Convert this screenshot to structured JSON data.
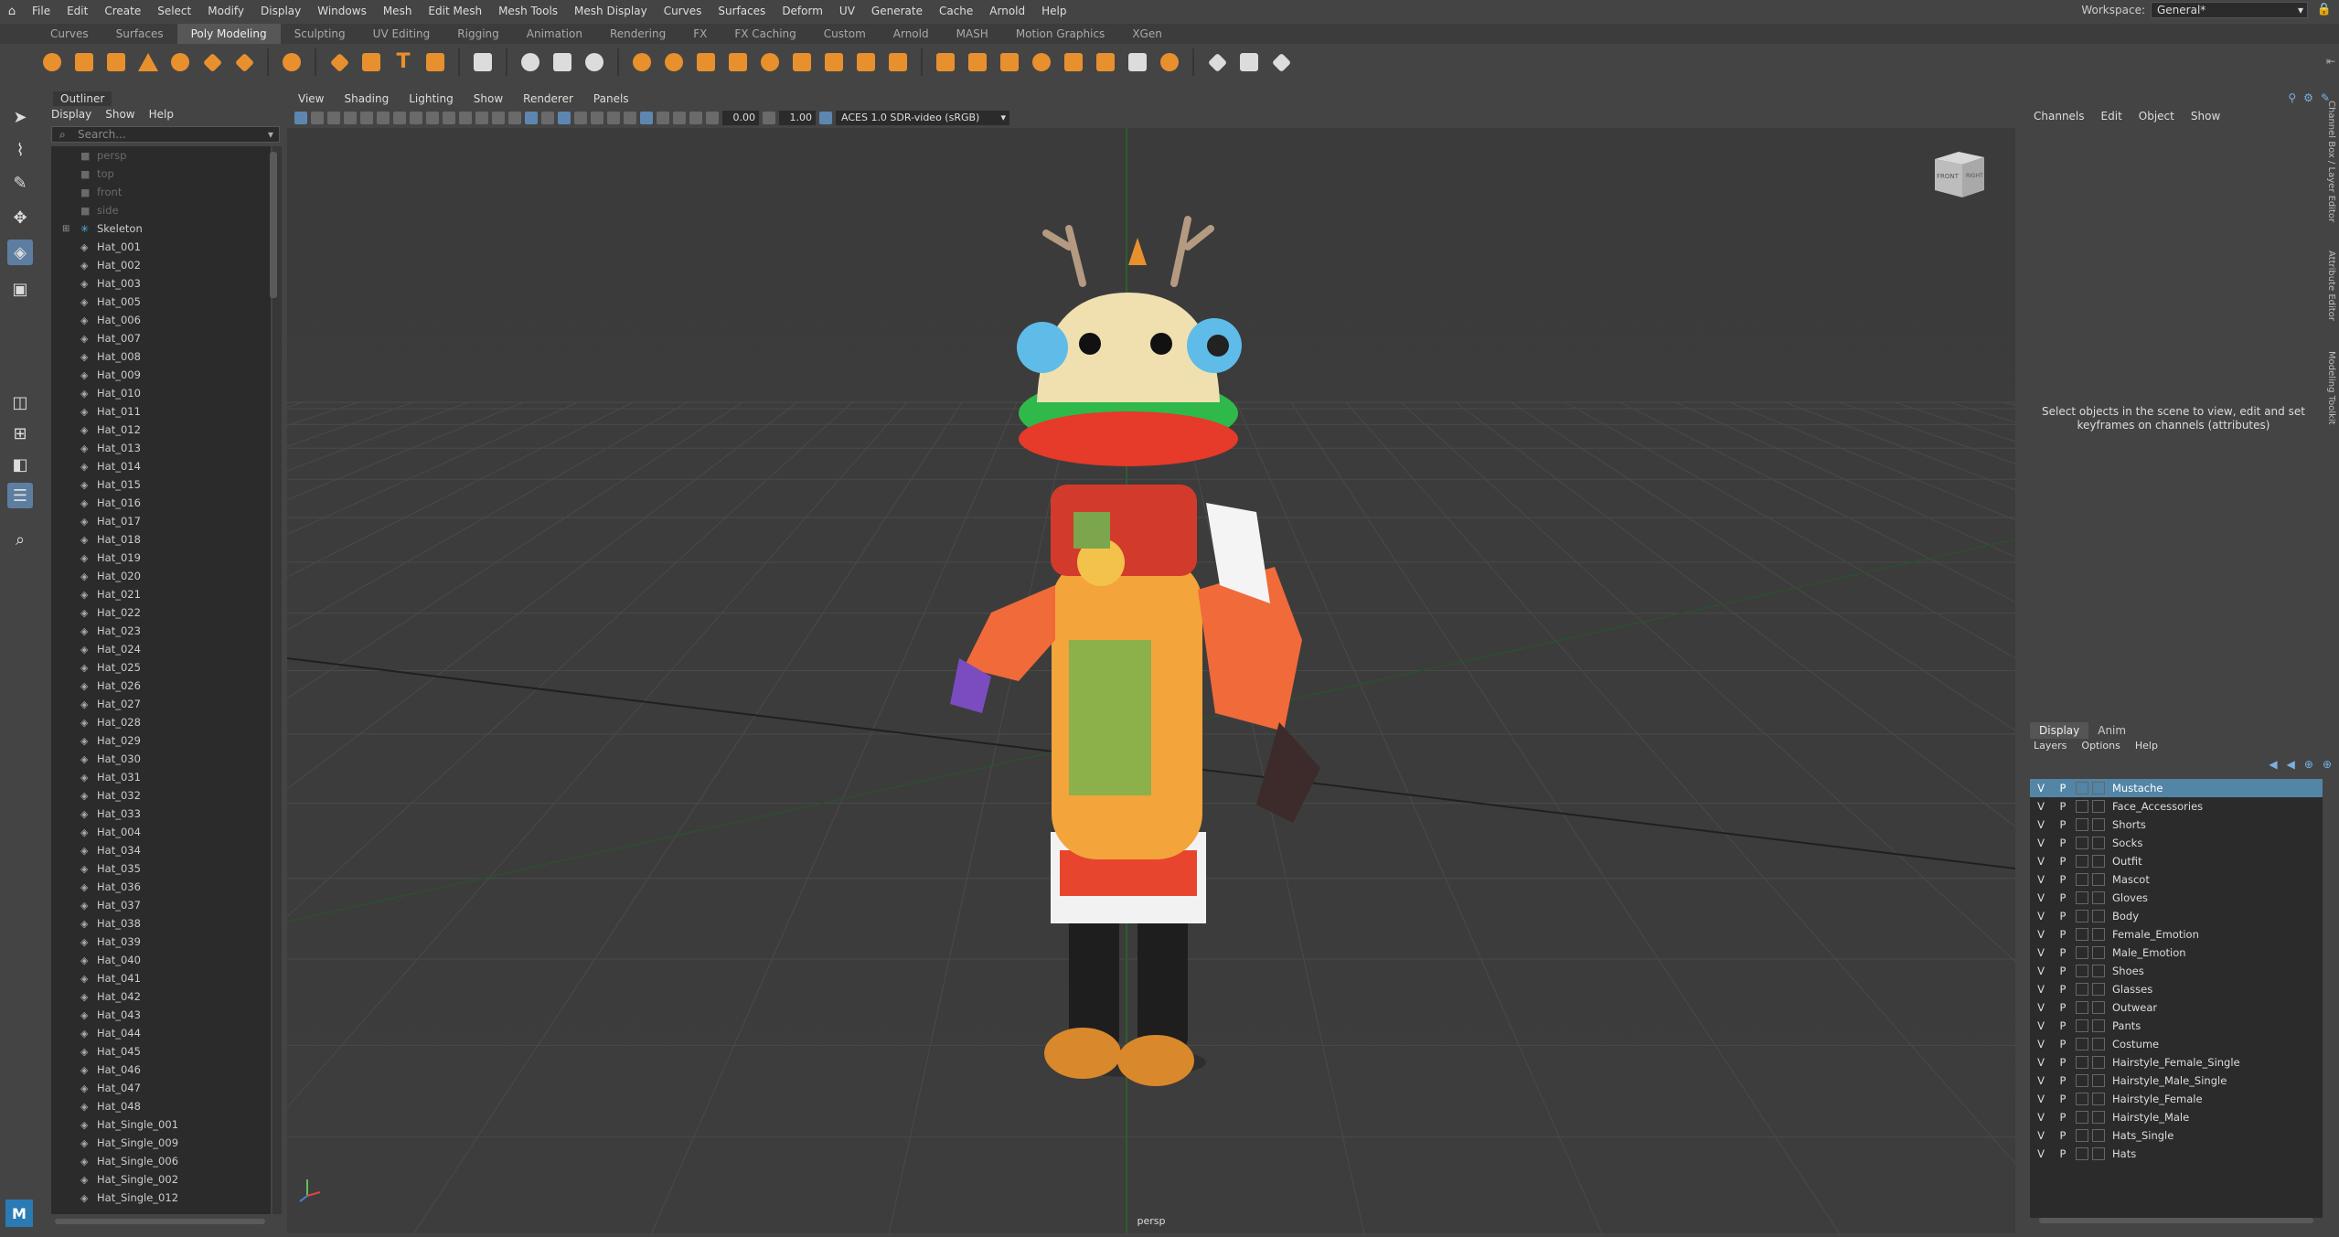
{
  "menubar": {
    "items": [
      "File",
      "Edit",
      "Create",
      "Select",
      "Modify",
      "Display",
      "Windows",
      "Mesh",
      "Edit Mesh",
      "Mesh Tools",
      "Mesh Display",
      "Curves",
      "Surfaces",
      "Deform",
      "UV",
      "Generate",
      "Cache",
      "Arnold",
      "Help"
    ],
    "workspace_label": "Workspace:",
    "workspace_value": "General*"
  },
  "shelf": {
    "tabs": [
      "Curves",
      "Surfaces",
      "Poly Modeling",
      "Sculpting",
      "UV Editing",
      "Rigging",
      "Animation",
      "Rendering",
      "FX",
      "FX Caching",
      "Custom",
      "Arnold",
      "MASH",
      "Motion Graphics",
      "XGen"
    ],
    "active_tab": "Poly Modeling"
  },
  "outliner": {
    "title": "Outliner",
    "menu": [
      "Display",
      "Show",
      "Help"
    ],
    "search_placeholder": "Search...",
    "items": [
      {
        "label": "persp",
        "type": "camera",
        "dim": true
      },
      {
        "label": "top",
        "type": "camera",
        "dim": true
      },
      {
        "label": "front",
        "type": "camera",
        "dim": true
      },
      {
        "label": "side",
        "type": "camera",
        "dim": true
      },
      {
        "label": "Skeleton",
        "type": "skeleton",
        "expandable": true
      },
      {
        "label": "Hat_001",
        "type": "mesh"
      },
      {
        "label": "Hat_002",
        "type": "mesh"
      },
      {
        "label": "Hat_003",
        "type": "mesh"
      },
      {
        "label": "Hat_005",
        "type": "mesh"
      },
      {
        "label": "Hat_006",
        "type": "mesh"
      },
      {
        "label": "Hat_007",
        "type": "mesh"
      },
      {
        "label": "Hat_008",
        "type": "mesh"
      },
      {
        "label": "Hat_009",
        "type": "mesh"
      },
      {
        "label": "Hat_010",
        "type": "mesh"
      },
      {
        "label": "Hat_011",
        "type": "mesh"
      },
      {
        "label": "Hat_012",
        "type": "mesh"
      },
      {
        "label": "Hat_013",
        "type": "mesh"
      },
      {
        "label": "Hat_014",
        "type": "mesh"
      },
      {
        "label": "Hat_015",
        "type": "mesh"
      },
      {
        "label": "Hat_016",
        "type": "mesh"
      },
      {
        "label": "Hat_017",
        "type": "mesh"
      },
      {
        "label": "Hat_018",
        "type": "mesh"
      },
      {
        "label": "Hat_019",
        "type": "mesh"
      },
      {
        "label": "Hat_020",
        "type": "mesh"
      },
      {
        "label": "Hat_021",
        "type": "mesh"
      },
      {
        "label": "Hat_022",
        "type": "mesh"
      },
      {
        "label": "Hat_023",
        "type": "mesh"
      },
      {
        "label": "Hat_024",
        "type": "mesh"
      },
      {
        "label": "Hat_025",
        "type": "mesh"
      },
      {
        "label": "Hat_026",
        "type": "mesh"
      },
      {
        "label": "Hat_027",
        "type": "mesh"
      },
      {
        "label": "Hat_028",
        "type": "mesh"
      },
      {
        "label": "Hat_029",
        "type": "mesh"
      },
      {
        "label": "Hat_030",
        "type": "mesh"
      },
      {
        "label": "Hat_031",
        "type": "mesh"
      },
      {
        "label": "Hat_032",
        "type": "mesh"
      },
      {
        "label": "Hat_033",
        "type": "mesh"
      },
      {
        "label": "Hat_004",
        "type": "mesh"
      },
      {
        "label": "Hat_034",
        "type": "mesh"
      },
      {
        "label": "Hat_035",
        "type": "mesh"
      },
      {
        "label": "Hat_036",
        "type": "mesh"
      },
      {
        "label": "Hat_037",
        "type": "mesh"
      },
      {
        "label": "Hat_038",
        "type": "mesh"
      },
      {
        "label": "Hat_039",
        "type": "mesh"
      },
      {
        "label": "Hat_040",
        "type": "mesh"
      },
      {
        "label": "Hat_041",
        "type": "mesh"
      },
      {
        "label": "Hat_042",
        "type": "mesh"
      },
      {
        "label": "Hat_043",
        "type": "mesh"
      },
      {
        "label": "Hat_044",
        "type": "mesh"
      },
      {
        "label": "Hat_045",
        "type": "mesh"
      },
      {
        "label": "Hat_046",
        "type": "mesh"
      },
      {
        "label": "Hat_047",
        "type": "mesh"
      },
      {
        "label": "Hat_048",
        "type": "mesh"
      },
      {
        "label": "Hat_Single_001",
        "type": "mesh"
      },
      {
        "label": "Hat_Single_009",
        "type": "mesh"
      },
      {
        "label": "Hat_Single_006",
        "type": "mesh"
      },
      {
        "label": "Hat_Single_002",
        "type": "mesh"
      },
      {
        "label": "Hat_Single_012",
        "type": "mesh"
      }
    ]
  },
  "viewport": {
    "menu": [
      "View",
      "Shading",
      "Lighting",
      "Show",
      "Renderer",
      "Panels"
    ],
    "exposure_value": "0.00",
    "gamma_value": "1.00",
    "colorspace": "ACES 1.0 SDR-video (sRGB)",
    "camera_label": "persp",
    "viewcube_front": "FRONT",
    "viewcube_right": "RIGHT"
  },
  "channelbox": {
    "menu": [
      "Channels",
      "Edit",
      "Object",
      "Show"
    ],
    "message": "Select objects in the scene to view, edit and set keyframes on channels (attributes)",
    "side_tabs": [
      "Channel Box / Layer Editor",
      "Attribute Editor",
      "Modeling Toolkit"
    ]
  },
  "layers": {
    "tabs": [
      "Display",
      "Anim"
    ],
    "active_tab": "Display",
    "menu": [
      "Layers",
      "Options",
      "Help"
    ],
    "v_label": "V",
    "p_label": "P",
    "items": [
      {
        "name": "Mustache",
        "selected": true
      },
      {
        "name": "Face_Accessories"
      },
      {
        "name": "Shorts"
      },
      {
        "name": "Socks"
      },
      {
        "name": "Outfit"
      },
      {
        "name": "Mascot"
      },
      {
        "name": "Gloves"
      },
      {
        "name": "Body"
      },
      {
        "name": "Female_Emotion"
      },
      {
        "name": "Male_Emotion"
      },
      {
        "name": "Shoes"
      },
      {
        "name": "Glasses"
      },
      {
        "name": "Outwear"
      },
      {
        "name": "Pants"
      },
      {
        "name": "Costume"
      },
      {
        "name": "Hairstyle_Female_Single"
      },
      {
        "name": "Hairstyle_Male_Single"
      },
      {
        "name": "Hairstyle_Female"
      },
      {
        "name": "Hairstyle_Male"
      },
      {
        "name": "Hats_Single"
      },
      {
        "name": "Hats"
      }
    ]
  },
  "app_logo": "M",
  "colors": {
    "accent": "#5285a6",
    "shelf_icon": "#e8902e",
    "viewport_bg": "#3a3a3a"
  }
}
